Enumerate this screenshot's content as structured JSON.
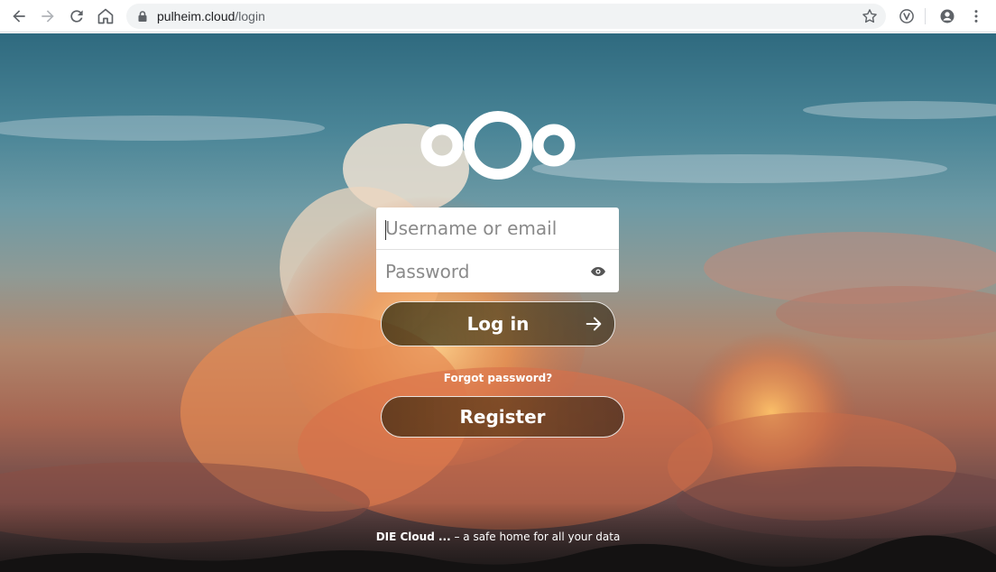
{
  "browser": {
    "url_host": "pulheim.cloud",
    "url_path": "/login",
    "icons": [
      "back-icon",
      "forward-icon",
      "reload-icon",
      "home-icon",
      "lock-icon",
      "star-icon",
      "vivaldi-extension-icon",
      "profile-icon",
      "menu-icon"
    ]
  },
  "login": {
    "username_placeholder": "Username or email",
    "password_placeholder": "Password",
    "login_label": "Log in",
    "forgot_label": "Forgot password?",
    "register_label": "Register"
  },
  "footer": {
    "brand": "DIE Cloud ...",
    "tagline": " – a safe home for all your data"
  },
  "colors": {
    "field_bg": "#ffffff",
    "text_white": "#ffffff"
  }
}
